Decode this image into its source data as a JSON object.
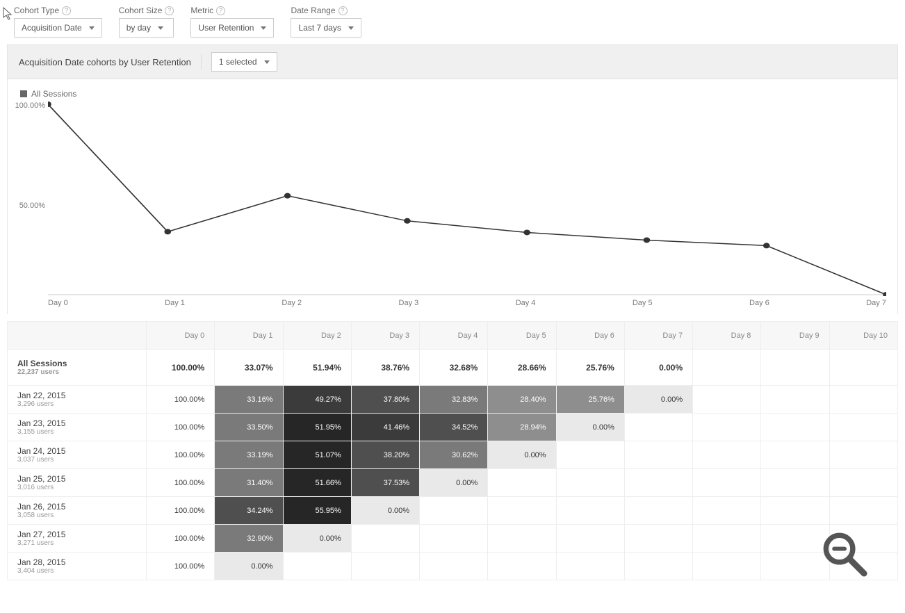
{
  "controls": {
    "cohort_type": {
      "label": "Cohort Type",
      "value": "Acquisition Date"
    },
    "cohort_size": {
      "label": "Cohort Size",
      "value": "by day"
    },
    "metric": {
      "label": "Metric",
      "value": "User Retention"
    },
    "date_range": {
      "label": "Date Range",
      "value": "Last 7 days"
    }
  },
  "panel": {
    "title": "Acquisition Date cohorts by User Retention",
    "selector": "1 selected"
  },
  "legend": "All Sessions",
  "chart_data": {
    "type": "line",
    "categories": [
      "Day 0",
      "Day 1",
      "Day 2",
      "Day 3",
      "Day 4",
      "Day 5",
      "Day 6",
      "Day 7"
    ],
    "values": [
      100.0,
      33.07,
      51.94,
      38.76,
      32.68,
      28.66,
      25.76,
      0.0
    ],
    "ylim": [
      0,
      100
    ],
    "yticks": [
      "100.00%",
      "50.00%"
    ],
    "title": "",
    "xlabel": "",
    "ylabel": ""
  },
  "table": {
    "headers": [
      "Day 0",
      "Day 1",
      "Day 2",
      "Day 3",
      "Day 4",
      "Day 5",
      "Day 6",
      "Day 7",
      "Day 8",
      "Day 9",
      "Day 10"
    ],
    "summary": {
      "title": "All Sessions",
      "sub": "22,237 users",
      "cells": [
        "100.00%",
        "33.07%",
        "51.94%",
        "38.76%",
        "32.68%",
        "28.66%",
        "25.76%",
        "0.00%",
        "",
        "",
        ""
      ]
    },
    "rows": [
      {
        "title": "Jan 22, 2015",
        "sub": "3,296 users",
        "cells": [
          "100.00%",
          "33.16%",
          "49.27%",
          "37.80%",
          "32.83%",
          "28.40%",
          "25.76%",
          "0.00%",
          "",
          "",
          ""
        ]
      },
      {
        "title": "Jan 23, 2015",
        "sub": "3,155 users",
        "cells": [
          "100.00%",
          "33.50%",
          "51.95%",
          "41.46%",
          "34.52%",
          "28.94%",
          "0.00%",
          "",
          "",
          "",
          ""
        ]
      },
      {
        "title": "Jan 24, 2015",
        "sub": "3,037 users",
        "cells": [
          "100.00%",
          "33.19%",
          "51.07%",
          "38.20%",
          "30.62%",
          "0.00%",
          "",
          "",
          "",
          "",
          ""
        ]
      },
      {
        "title": "Jan 25, 2015",
        "sub": "3,016 users",
        "cells": [
          "100.00%",
          "31.40%",
          "51.66%",
          "37.53%",
          "0.00%",
          "",
          "",
          "",
          "",
          "",
          ""
        ]
      },
      {
        "title": "Jan 26, 2015",
        "sub": "3,058 users",
        "cells": [
          "100.00%",
          "34.24%",
          "55.95%",
          "0.00%",
          "",
          "",
          "",
          "",
          "",
          "",
          ""
        ]
      },
      {
        "title": "Jan 27, 2015",
        "sub": "3,271 users",
        "cells": [
          "100.00%",
          "32.90%",
          "0.00%",
          "",
          "",
          "",
          "",
          "",
          "",
          "",
          ""
        ]
      },
      {
        "title": "Jan 28, 2015",
        "sub": "3,404 users",
        "cells": [
          "100.00%",
          "0.00%",
          "",
          "",
          "",
          "",
          "",
          "",
          "",
          "",
          ""
        ]
      }
    ]
  }
}
